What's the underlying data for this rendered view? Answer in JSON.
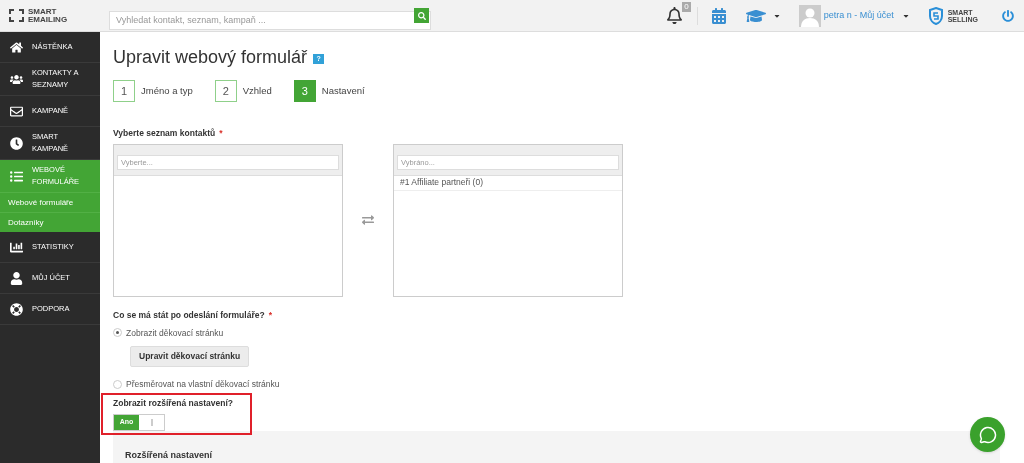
{
  "header": {
    "logo": [
      "SMART",
      "EMAILING"
    ],
    "search": {
      "placeholder": "Vyhledat kontakt, seznam, kampaň ..."
    },
    "notification_count": "0",
    "user": "petra n - Můj účet",
    "brand": [
      "SMART",
      "SELLING"
    ]
  },
  "sidebar": {
    "items": [
      {
        "label": "NÁSTĚNKA",
        "selected": false
      },
      {
        "label": "KONTAKTY A SEZNAMY",
        "selected": false
      },
      {
        "label": "KAMPANĚ",
        "selected": false
      },
      {
        "label": "SMART KAMPANĚ",
        "selected": false
      },
      {
        "label": "WEBOVÉ FORMULÁŘE",
        "selected": true,
        "children": [
          {
            "label": "Webové formuláře"
          },
          {
            "label": "Dotazníky"
          }
        ]
      },
      {
        "label": "STATISTIKY",
        "selected": false
      },
      {
        "label": "MŮJ ÚČET",
        "selected": false
      },
      {
        "label": "PODPORA",
        "selected": false
      }
    ]
  },
  "page": {
    "title": "Upravit webový formulář",
    "help": "?",
    "steps": [
      {
        "number": "1",
        "label": "Jméno a typ",
        "selected": false
      },
      {
        "number": "2",
        "label": "Vzhled",
        "selected": false
      },
      {
        "number": "3",
        "label": "Nastavení",
        "selected": true
      }
    ],
    "contact_lists": {
      "label": "Vyberte seznam kontaktů",
      "required": "*",
      "available": {
        "placeholder": "Vyberte..."
      },
      "chosen": {
        "placeholder": "Vybráno...",
        "items": [
          "#1 Affiliate partneři (0)"
        ]
      }
    },
    "after_submit": {
      "label": "Co se má stát po odeslání formuláře?",
      "required": "*",
      "options": [
        {
          "label": "Zobrazit děkovací stránku",
          "selected": true
        },
        {
          "label": "Přesměrovat na vlastní děkovací stránku",
          "selected": false
        }
      ],
      "button": "Upravit děkovací stránku"
    },
    "advanced": {
      "label": "Zobrazit rozšířená nastavení?",
      "on": true,
      "on_text": "Ano",
      "panel_title": "Rozšířená nastavení"
    }
  }
}
